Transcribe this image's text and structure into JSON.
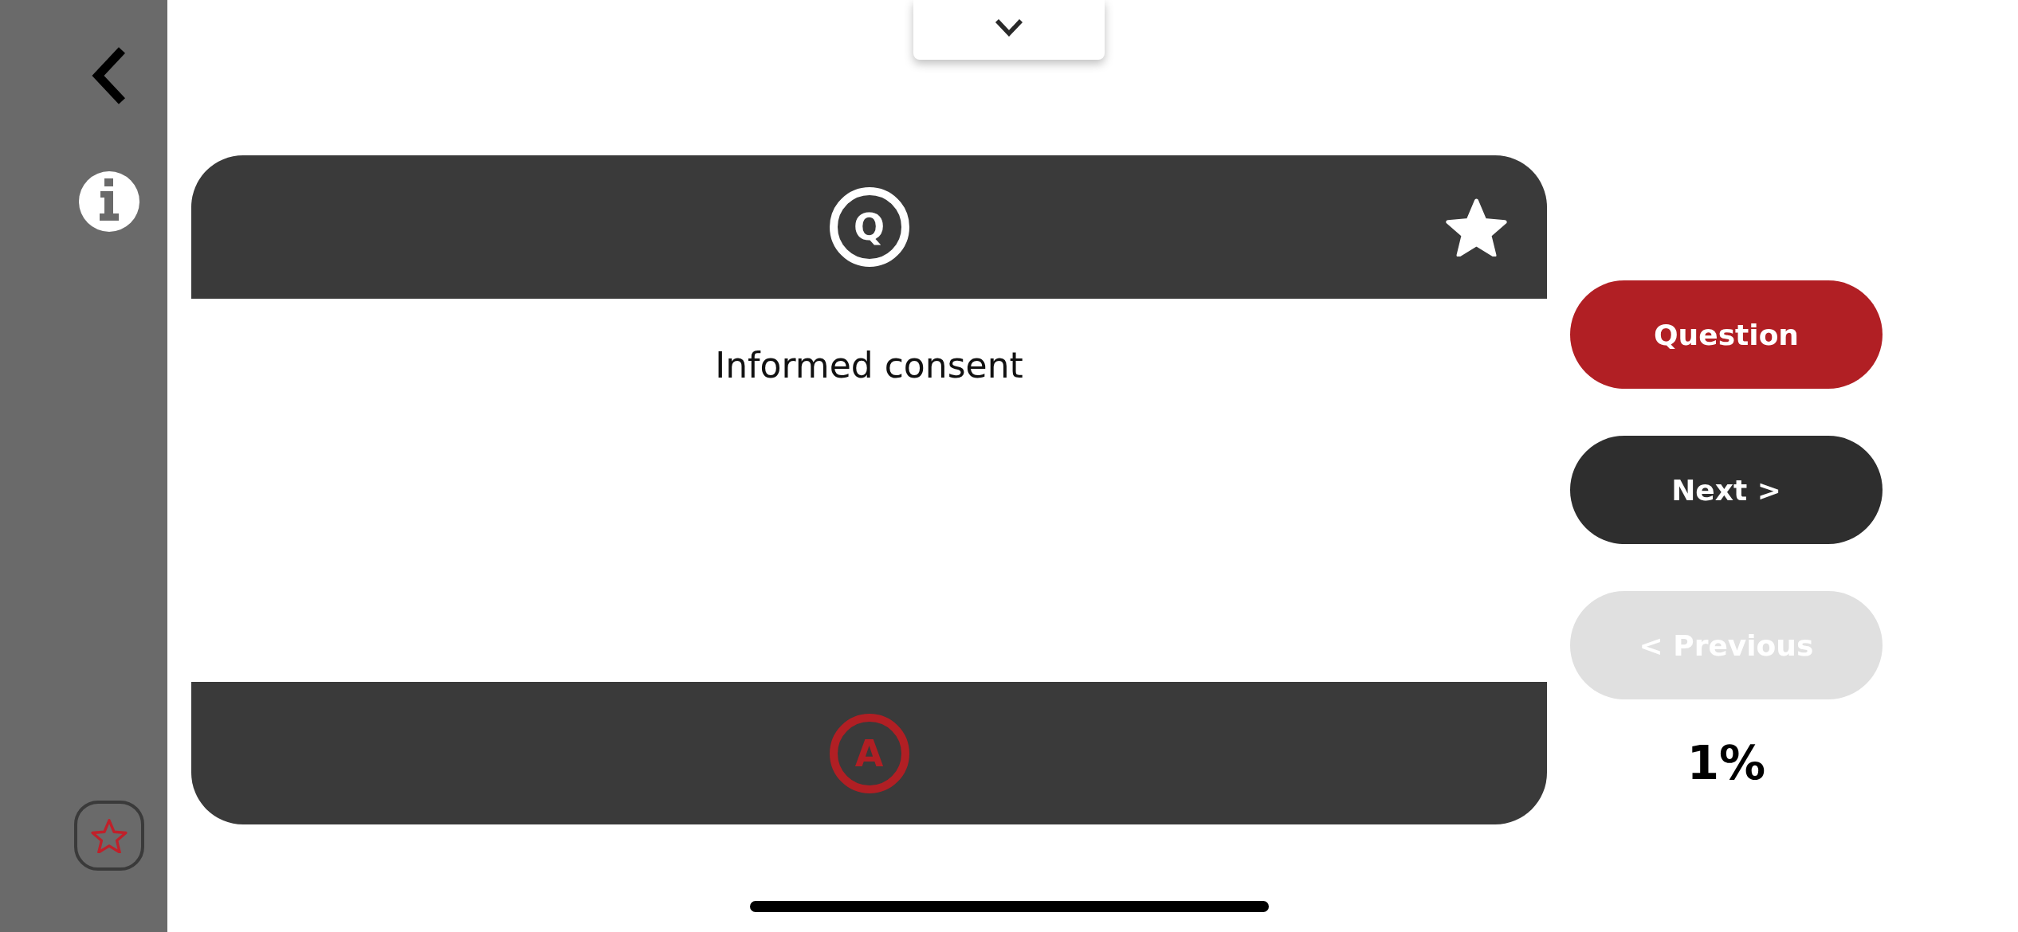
{
  "card": {
    "header_badge": "Q",
    "question": "Informed consent",
    "footer_badge": "A"
  },
  "buttons": [
    {
      "label": "Question",
      "kind": "toggle",
      "disabled": false
    },
    {
      "label": "Next >",
      "kind": "nav",
      "disabled": false
    },
    {
      "label": "< Previous",
      "kind": "nav",
      "disabled": true
    }
  ],
  "progress": "1%"
}
